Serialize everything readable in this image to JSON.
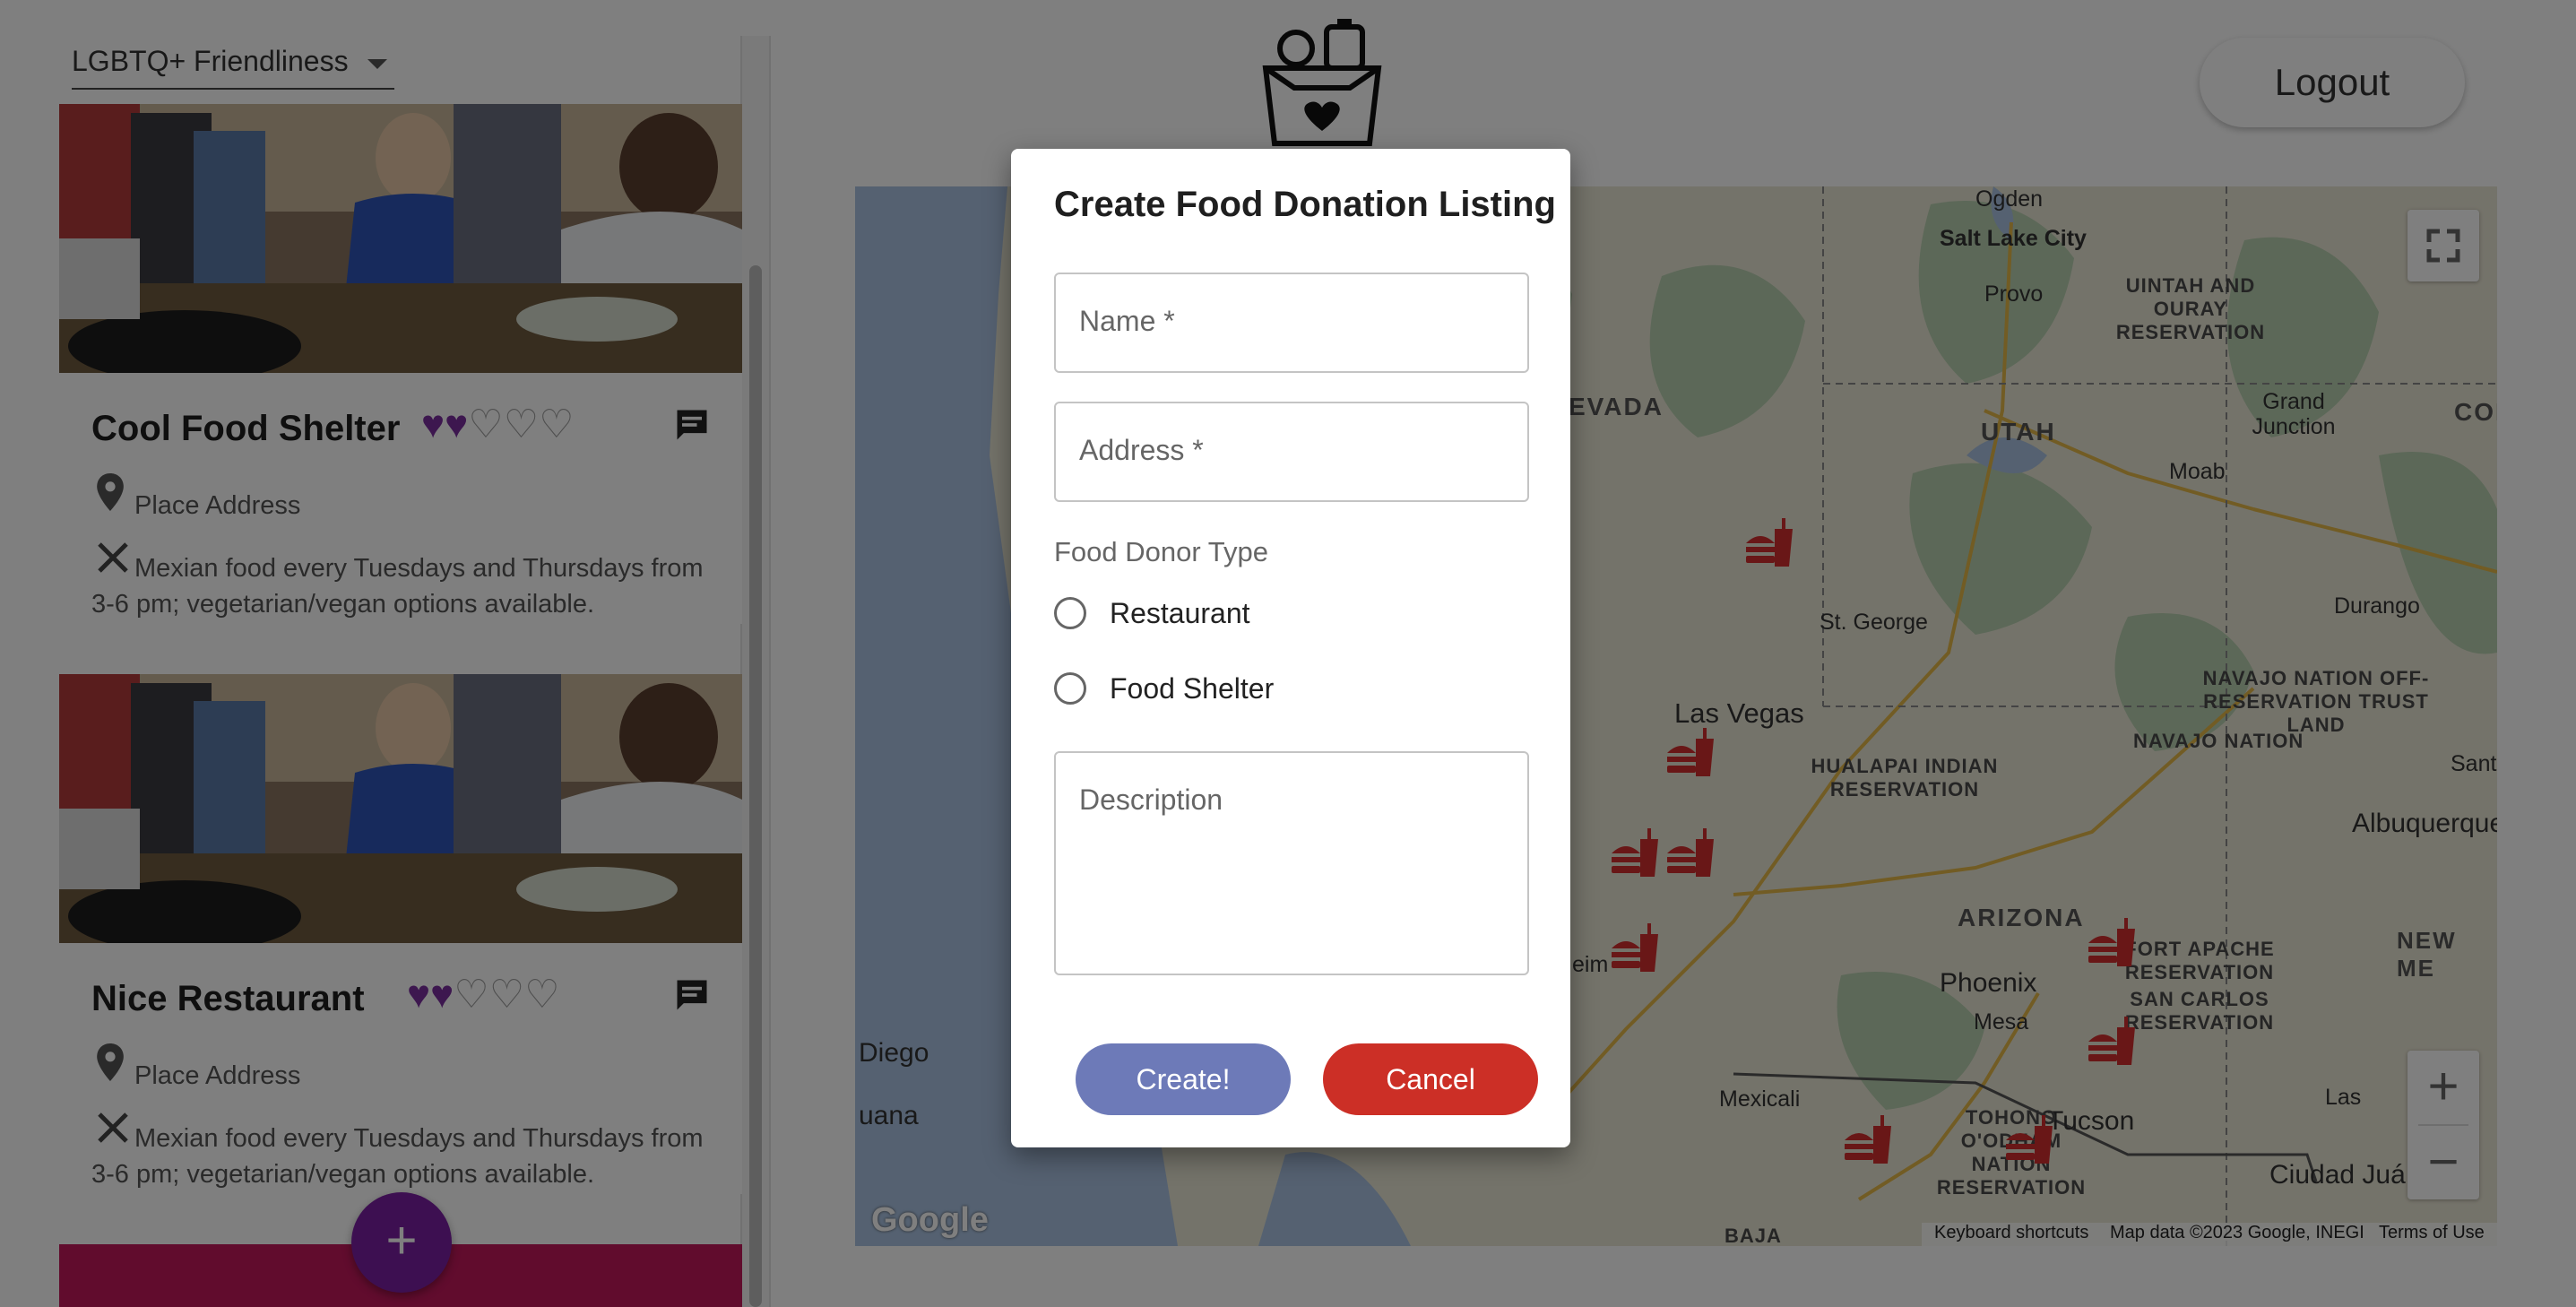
{
  "filter": {
    "label": "LGBTQ+ Friendliness"
  },
  "header": {
    "logout_label": "Logout"
  },
  "listings": [
    {
      "title": "Cool Food Shelter",
      "rating": 2,
      "max_rating": 5,
      "address": "Place Address",
      "description": "Mexian food every Tuesdays and Thursdays from 3-6 pm; vegetarian/vegan options available."
    },
    {
      "title": "Nice Restaurant",
      "rating": 2,
      "max_rating": 5,
      "address": "Place Address",
      "description": "Mexian food every Tuesdays and Thursdays from 3-6 pm; vegetarian/vegan options available."
    }
  ],
  "fab": {
    "label": "+"
  },
  "map": {
    "places": [
      "Ogden",
      "Salt Lake City",
      "Provo",
      "UINTAH AND OURAY RESERVATION",
      "Grand Junction",
      "UTAH",
      "Moab",
      "St. George",
      "Durango",
      "Las Vegas",
      "NAVAJO NATION OFF-RESERVATION TRUST LAND",
      "NAVAJO NATION",
      "HUALAPAI INDIAN RESERVATION",
      "Santa",
      "Albuquerque",
      "ARIZONA",
      "NEW ME",
      "FORT APACHE RESERVATION",
      "Phoenix",
      "Mesa",
      "SAN CARLOS RESERVATION",
      "Diego",
      "Mexicali",
      "Tucson",
      "TOHONO O'ODHAM NATION RESERVATION",
      "uana",
      "Las",
      "Ciudad Juá",
      "BAJA",
      "EVADA",
      "COL",
      "eim"
    ],
    "attribution": {
      "logo": "Google",
      "shortcuts": "Keyboard shortcuts",
      "data": "Map data ©2023 Google, INEGI",
      "terms": "Terms of Use"
    },
    "zoom_in": "+",
    "zoom_out": "−"
  },
  "dialog": {
    "title": "Create Food Donation Listing",
    "name_placeholder": "Name *",
    "address_placeholder": "Address *",
    "donor_type_label": "Food Donor Type",
    "options": [
      "Restaurant",
      "Food Shelter"
    ],
    "description_placeholder": "Description",
    "create_label": "Create!",
    "cancel_label": "Cancel"
  },
  "colors": {
    "heart_on": "#7b2e9e",
    "create_button": "#6d7ab8",
    "cancel_button": "#cc2f26",
    "marker": "#d32f2f",
    "fab": "#7b1fa2"
  }
}
